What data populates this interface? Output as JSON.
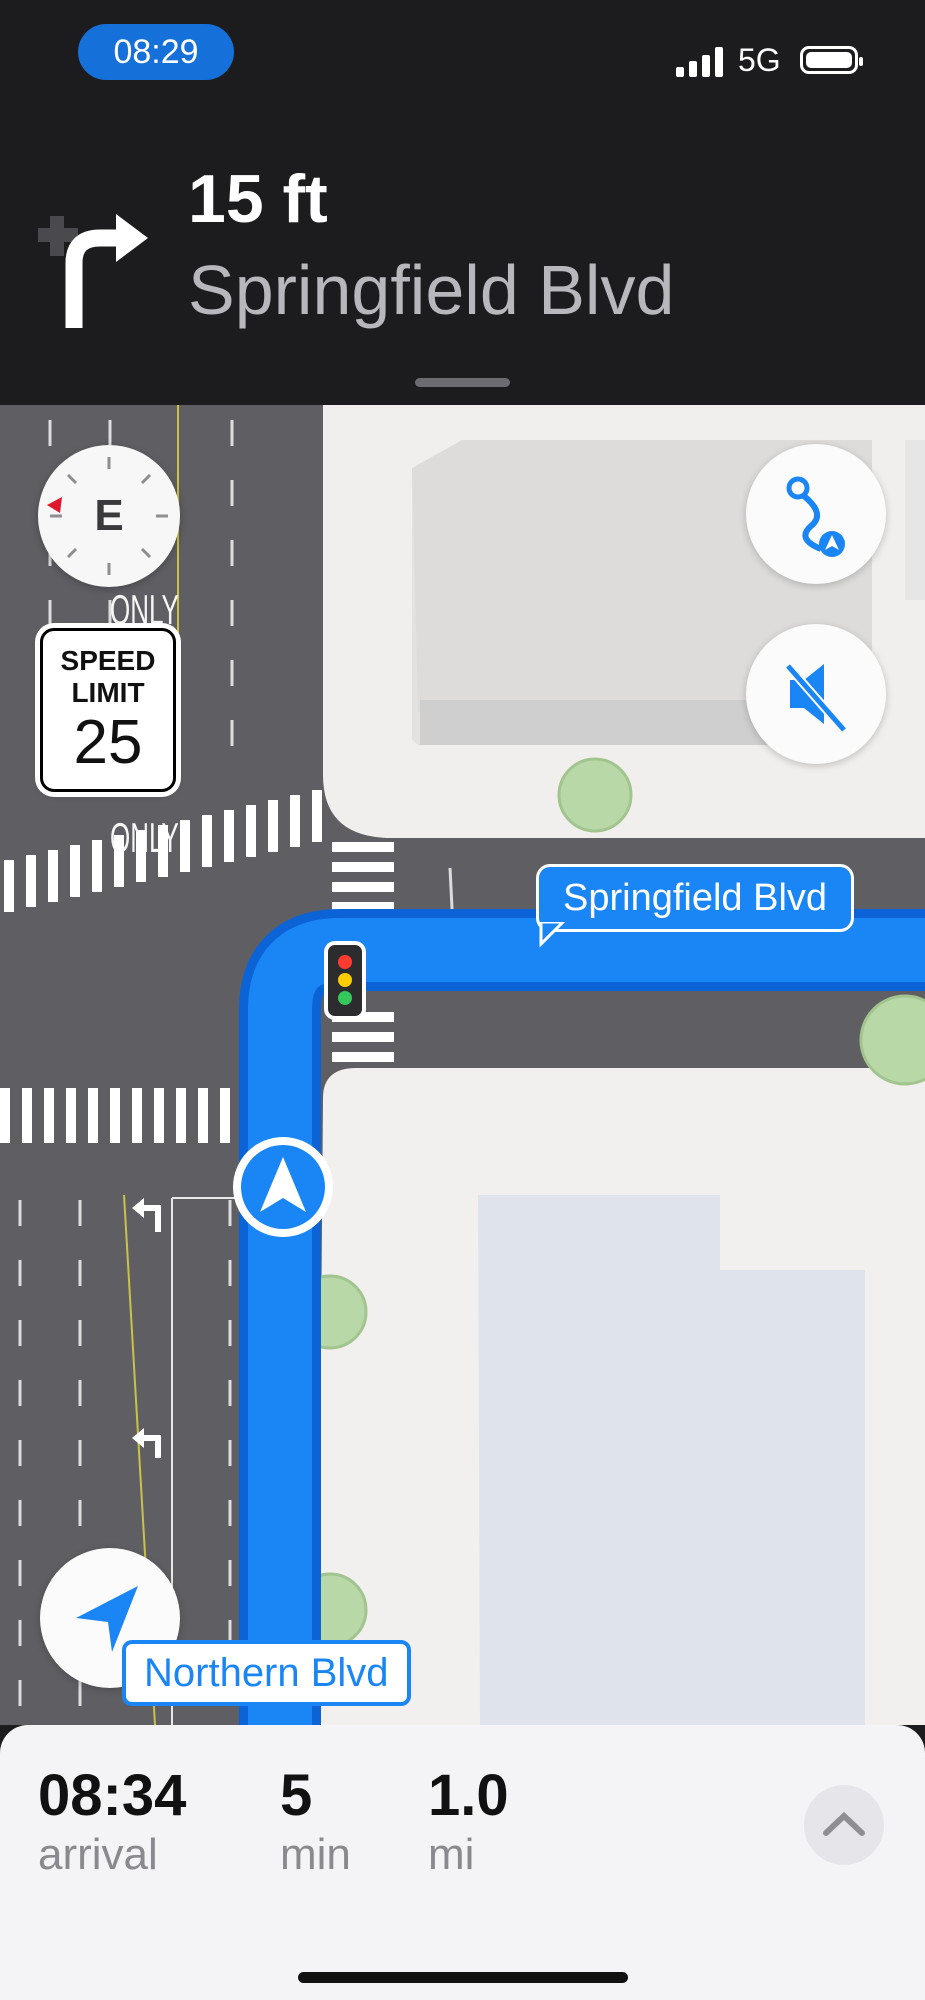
{
  "status_bar": {
    "time": "08:29",
    "network": "5G",
    "signal_icon": "signal-bars-icon",
    "battery_icon": "battery-icon"
  },
  "navigation": {
    "maneuver_icon": "turn-right-arrow-icon",
    "distance": "15 ft",
    "street": "Springfield Blvd"
  },
  "map": {
    "compass_heading": "E",
    "speed_limit": {
      "label_line1": "SPEED",
      "label_line2": "LIMIT",
      "value": "25"
    },
    "road_marking_only": "ONLY",
    "current_street_callout": "Springfield Blvd",
    "street_label": "Northern Blvd",
    "route_color": "#1a86f5",
    "buttons": {
      "route_overview_icon": "route-overview-icon",
      "mute_icon": "speaker-muted-icon",
      "locate_icon": "location-arrow-icon"
    }
  },
  "trip": {
    "arrival_time": "08:34",
    "arrival_label": "arrival",
    "duration_value": "5",
    "duration_label": "min",
    "distance_value": "1.0",
    "distance_label": "mi",
    "expand_icon": "chevron-up-icon"
  }
}
